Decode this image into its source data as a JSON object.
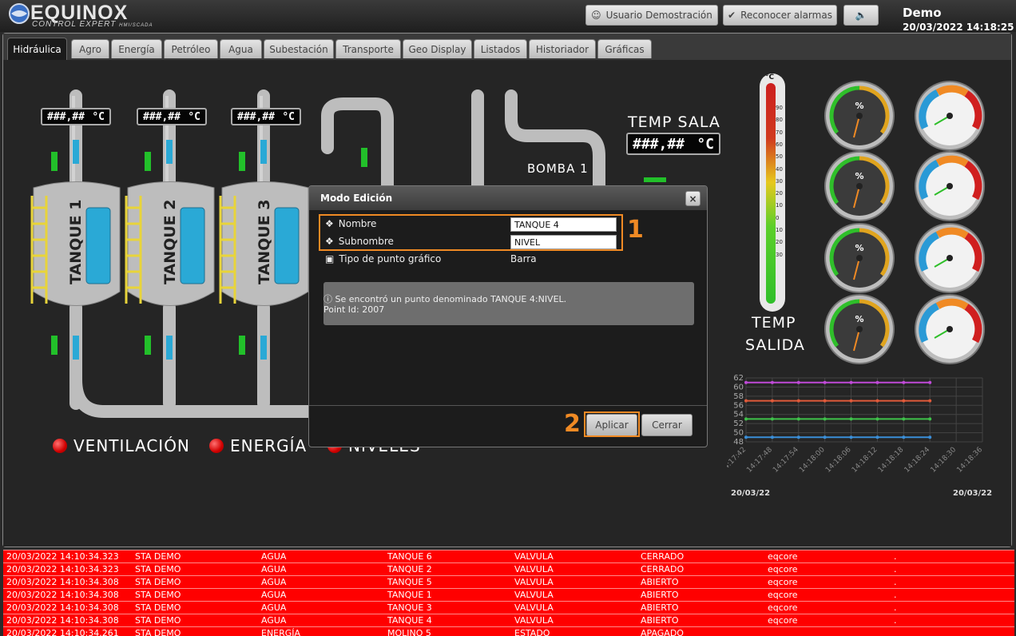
{
  "app": {
    "logo_name": "EQUINOX",
    "logo_sub": "CONTROL EXPERT",
    "logo_sub_small": "HMI/SCADA",
    "user_btn": "Usuario Demostración",
    "alarm_btn": "Reconocer alarmas",
    "user_name": "Demo",
    "datetime": "20/03/2022 14:18:25"
  },
  "tabs": [
    "Hidráulica",
    "Agro",
    "Energía",
    "Petróleo",
    "Agua",
    "Subestación",
    "Transporte",
    "Geo Display",
    "Listados",
    "Historiador",
    "Gráficas"
  ],
  "scada": {
    "lcd_value": "###,##",
    "lcd_unit": "°C",
    "tanks": [
      "TANQUE 1",
      "TANQUE 2",
      "TANQUE 3"
    ],
    "temp_sala": "TEMP SALA",
    "bomba": "BOMBA 1",
    "thermo_unit": "°C",
    "thermo_ticks": [
      "90",
      "80",
      "70",
      "60",
      "50",
      "40",
      "30",
      "20",
      "10",
      "0",
      "10",
      "20",
      "30"
    ],
    "temp_salida_1": "TEMP",
    "temp_salida_2": "SALIDA",
    "status_labels": [
      "VENTILACIÓN",
      "ENERGÍA",
      "NIVELES"
    ],
    "gauge_pct_symbol": "%"
  },
  "modal": {
    "title": "Modo Edición",
    "close": "×",
    "nombre_label": "Nombre",
    "nombre_value": "TANQUE 4",
    "subnombre_label": "Subnombre",
    "subnombre_value": "NIVEL",
    "tipo_label": "Tipo de punto gráfico",
    "tipo_value": "Barra",
    "info_line1": "Se encontró un punto denominado TANQUE 4:NIVEL.",
    "info_line2": "Point Id: 2007",
    "apply": "Aplicar",
    "close_btn": "Cerrar",
    "step1": "1",
    "step2": "2"
  },
  "chart_data": {
    "type": "line",
    "x": [
      "14:17:42",
      "14:17:48",
      "14:17:54",
      "14:18:00",
      "14:18:06",
      "14:18:12",
      "14:18:18",
      "14:18:24",
      "14:18:30",
      "14:18:36"
    ],
    "ylim": [
      48,
      62
    ],
    "yticks": [
      "62",
      "60",
      "58",
      "56",
      "54",
      "52",
      "50",
      "48"
    ],
    "date_left": "20/03/22",
    "date_right": "20/03/22",
    "series": [
      {
        "color": "#c04ad8",
        "values": [
          61,
          61,
          61,
          61,
          61,
          61,
          61,
          61
        ]
      },
      {
        "color": "#e05a3a",
        "values": [
          57,
          57,
          57,
          57,
          57,
          57,
          57,
          57
        ]
      },
      {
        "color": "#3fc24a",
        "values": [
          53,
          53,
          53,
          53,
          53,
          53,
          53,
          53
        ]
      },
      {
        "color": "#3a8ed8",
        "values": [
          49,
          49,
          49,
          49,
          49,
          49,
          49,
          49
        ]
      }
    ]
  },
  "alarms": [
    {
      "time": "20/03/2022 14:10:34.323",
      "sta": "STA DEMO",
      "area": "AGUA",
      "obj": "TANQUE 6",
      "type": "VALVULA",
      "state": "CERRADO",
      "user": "eqcore",
      "mark": "."
    },
    {
      "time": "20/03/2022 14:10:34.323",
      "sta": "STA DEMO",
      "area": "AGUA",
      "obj": "TANQUE 2",
      "type": "VALVULA",
      "state": "CERRADO",
      "user": "eqcore",
      "mark": "."
    },
    {
      "time": "20/03/2022 14:10:34.308",
      "sta": "STA DEMO",
      "area": "AGUA",
      "obj": "TANQUE 5",
      "type": "VALVULA",
      "state": "ABIERTO",
      "user": "eqcore",
      "mark": "."
    },
    {
      "time": "20/03/2022 14:10:34.308",
      "sta": "STA DEMO",
      "area": "AGUA",
      "obj": "TANQUE 1",
      "type": "VALVULA",
      "state": "ABIERTO",
      "user": "eqcore",
      "mark": "."
    },
    {
      "time": "20/03/2022 14:10:34.308",
      "sta": "STA DEMO",
      "area": "AGUA",
      "obj": "TANQUE 3",
      "type": "VALVULA",
      "state": "ABIERTO",
      "user": "eqcore",
      "mark": "."
    },
    {
      "time": "20/03/2022 14:10:34.308",
      "sta": "STA DEMO",
      "area": "AGUA",
      "obj": "TANQUE 4",
      "type": "VALVULA",
      "state": "ABIERTO",
      "user": "eqcore",
      "mark": "."
    },
    {
      "time": "20/03/2022 14:10:34.261",
      "sta": "STA DEMO",
      "area": "ENERGÍA",
      "obj": "MOLINO 5",
      "type": "ESTADO",
      "state": "APAGADO",
      "user": "",
      "mark": ""
    }
  ]
}
